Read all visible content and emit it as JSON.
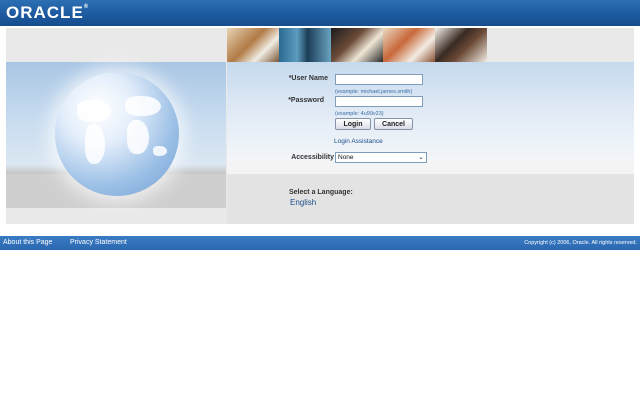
{
  "header": {
    "brand": "ORACLE",
    "trademark": "®",
    "bg_color": "#1d5aa0"
  },
  "login": {
    "username_label": "*User Name",
    "username_value": "",
    "username_example": "(example: michael.james.smith)",
    "password_label": "*Password",
    "password_value": "",
    "password_example": "(example: 4u99v23)",
    "login_button": "Login",
    "cancel_button": "Cancel",
    "assistance_link": "Login Assistance",
    "accessibility_label": "Accessibility",
    "accessibility_value": "None"
  },
  "language": {
    "label": "Select a Language:",
    "option": "English"
  },
  "footer": {
    "about_link": "About this Page",
    "privacy_link": "Privacy Statement",
    "copyright": "Copyright (c) 2006, Oracle. All rights reserved.",
    "bg_color": "#2a68b0"
  },
  "icons": [
    "globe-image",
    "people-photo-banner",
    "chevron-down-icon"
  ]
}
